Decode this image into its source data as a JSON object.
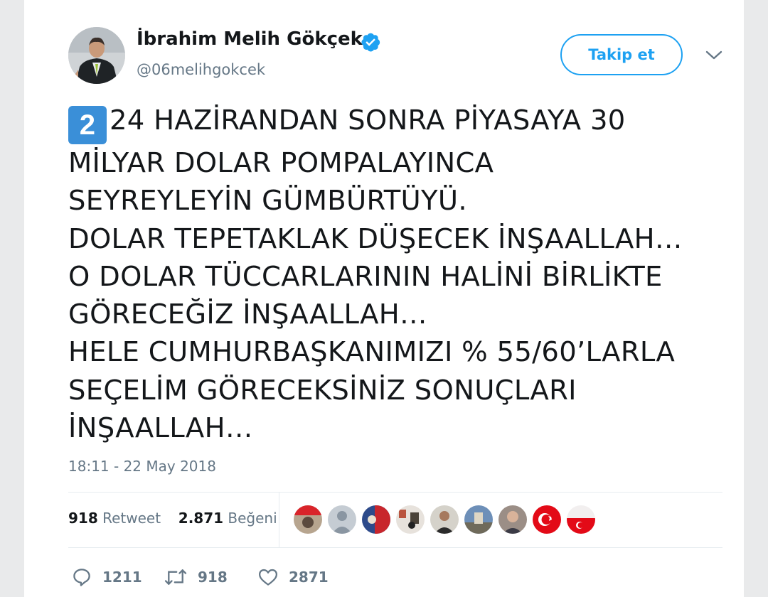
{
  "user": {
    "name": "İbrahim Melih Gökçek",
    "handle": "@06melihgokcek",
    "follow_label": "Takip et"
  },
  "tweet": {
    "keycap": "2",
    "lines": [
      "24 HAZİRANDAN SONRA PİYASAYA 30",
      "MİLYAR DOLAR POMPALAYINCA",
      "SEYREYLEYİN GÜMBÜRTÜYÜ.",
      "DOLAR TEPETAKLAK DÜŞECEK İNŞAALLAH…",
      "O DOLAR TÜCCARLARININ HALİNİ BİRLİKTE",
      "GÖRECEĞİZ İNŞAALLAH…",
      "HELE CUMHURBAŞKANIMIZI % 55/60’LARLA",
      "SEÇELİM GÖRECEKSİNİZ SONUÇLARI",
      "İNŞAALLAH…"
    ],
    "timestamp": "18:11 - 22 May 2018"
  },
  "stats": {
    "retweets_count": "918",
    "retweets_label": "Retweet",
    "likes_count": "2.871",
    "likes_label": "Beğeni"
  },
  "actions": {
    "reply_count": "1211",
    "retweet_count": "918",
    "like_count": "2871"
  },
  "colors": {
    "accent": "#1da1f2",
    "text": "#14171a",
    "muted": "#657786",
    "keycap": "#3a8fd8"
  },
  "icons": [
    "verified-badge-icon",
    "chevron-down-icon",
    "reply-icon",
    "retweet-icon",
    "heart-icon"
  ]
}
